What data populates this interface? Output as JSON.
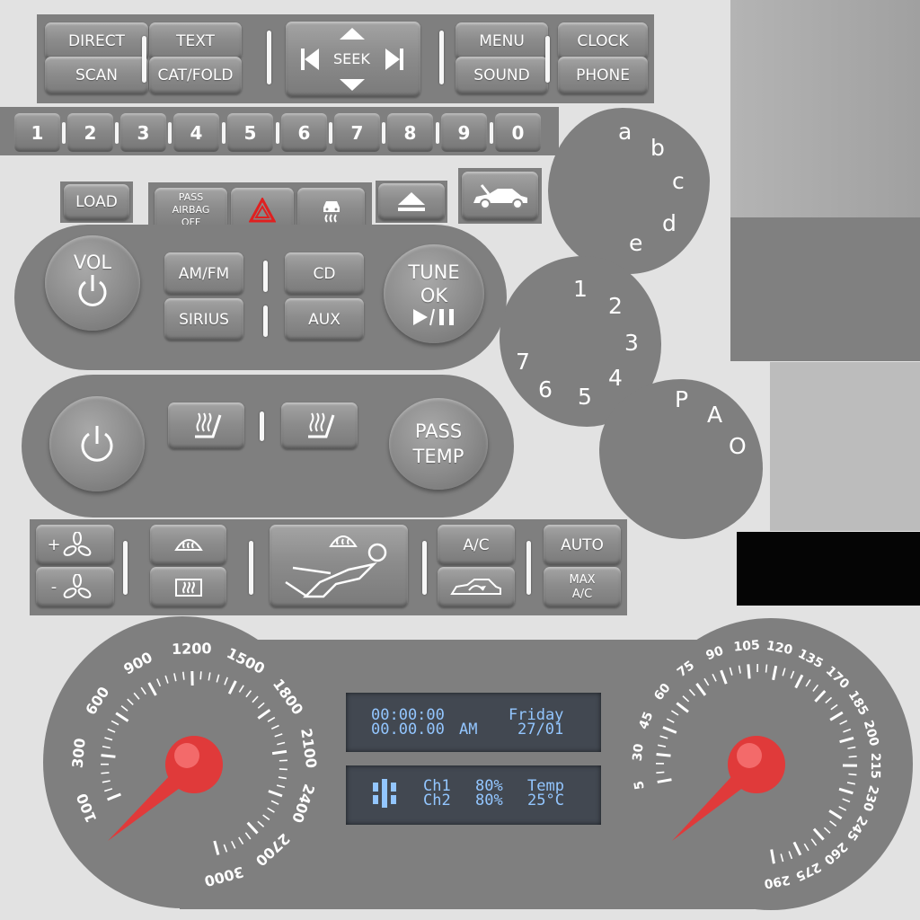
{
  "top_row": {
    "direct": "DIRECT",
    "scan": "SCAN",
    "text": "TEXT",
    "cat_fold": "CAT/FOLD",
    "seek": "SEEK",
    "menu": "MENU",
    "sound": "SOUND",
    "clock": "CLOCK",
    "phone": "PHONE"
  },
  "number_row": [
    "1",
    "2",
    "3",
    "4",
    "5",
    "6",
    "7",
    "8",
    "9",
    "0"
  ],
  "small_row": {
    "load": "LOAD",
    "airbag_line1": "PASS",
    "airbag_line2": "AIRBAG",
    "airbag_line3": "OFF"
  },
  "letter_dial": [
    "a",
    "b",
    "c",
    "d",
    "e"
  ],
  "number_dial": [
    "1",
    "2",
    "3",
    "4",
    "5",
    "6",
    "7"
  ],
  "gear_dial": [
    "P",
    "A",
    "O"
  ],
  "audio": {
    "vol": "VOL",
    "am_fm": "AM/FM",
    "sirius": "SIRIUS",
    "cd": "CD",
    "aux": "AUX",
    "tune": "TUNE",
    "ok": "OK"
  },
  "climate": {
    "pass_temp_line1": "PASS",
    "pass_temp_line2": "TEMP",
    "fan_plus": "+",
    "fan_minus": "-",
    "ac": "A/C",
    "auto": "AUTO",
    "max_ac_line1": "MAX",
    "max_ac_line2": "A/C"
  },
  "display1": {
    "time": "00:00:00",
    "time2": "00.00.00",
    "ampm": "AM",
    "day": "Friday",
    "date": "27/01"
  },
  "display2": {
    "ch1": "Ch1",
    "ch2": "Ch2",
    "ch1_value": "80%",
    "ch2_value": "80%",
    "temp_label": "Temp",
    "temp_value": "25°C"
  },
  "tachometer_labels": [
    "100",
    "300",
    "600",
    "900",
    "1200",
    "1500",
    "1800",
    "2100",
    "2400",
    "2700",
    "3000"
  ],
  "speedometer_labels": [
    "5",
    "30",
    "45",
    "60",
    "75",
    "90",
    "105",
    "120",
    "135",
    "170",
    "185",
    "200",
    "215",
    "230",
    "245",
    "260",
    "275",
    "290"
  ],
  "colors": {
    "panel": "#7f7f7f",
    "needle": "#e03a3a",
    "lcd_text": "#93c6ff",
    "hazard": "#e02020"
  }
}
